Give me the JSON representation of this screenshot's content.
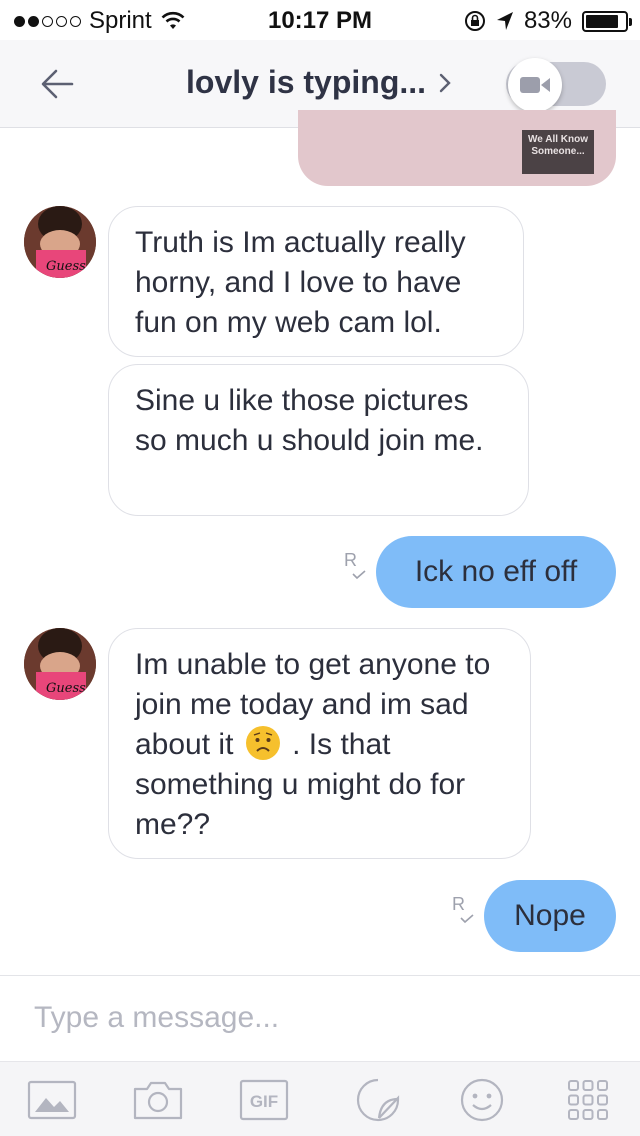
{
  "status_bar": {
    "carrier": "Sprint",
    "time": "10:17 PM",
    "battery": "83%",
    "signal_bars": 2,
    "battery_level": 0.83
  },
  "header": {
    "title": "lovly is typing...",
    "title_chevron": "›"
  },
  "image_message": {
    "caption_line1": "We All Know",
    "caption_line2": "Someone..."
  },
  "messages": [
    {
      "id": "m1",
      "direction": "incoming",
      "text": "Truth is Im actually really horny, and I love to have fun on my web cam lol."
    },
    {
      "id": "m2",
      "direction": "incoming",
      "text": "Sine u like those pictures so much u should join me."
    },
    {
      "id": "m3",
      "direction": "outgoing",
      "text": "Ick no eff off",
      "receipt": "R"
    },
    {
      "id": "m4",
      "direction": "incoming",
      "text_before_emoji": "Im unable to get anyone to join me today and im sad about it",
      "emoji": "worried-face",
      "text_after_emoji": ". Is that something u might do for me??"
    },
    {
      "id": "m5",
      "direction": "outgoing",
      "text": "Nope",
      "receipt": "R"
    }
  ],
  "composer": {
    "placeholder": "Type a message..."
  },
  "toolbar": {
    "gif_label": "GIF",
    "tools": [
      "image-icon",
      "camera-icon",
      "gif-icon",
      "sticker-icon",
      "smiley-icon",
      "more-grid-icon"
    ]
  },
  "colors": {
    "outgoing_bubble": "#7fbcf8",
    "incoming_border": "#dfe0e6",
    "header_bg": "#f7f7f9"
  }
}
